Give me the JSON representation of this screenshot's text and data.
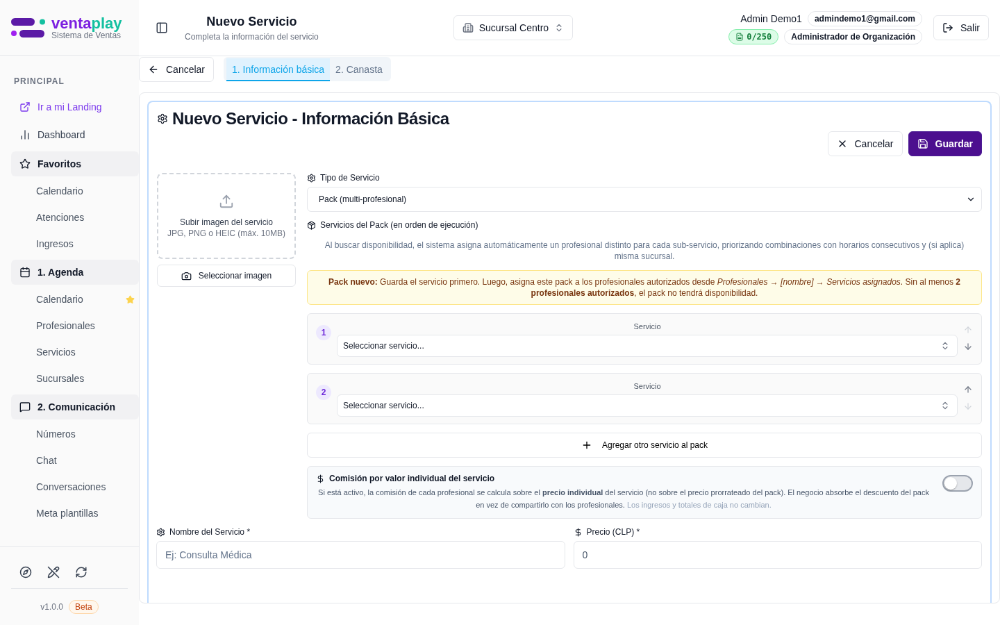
{
  "brand": {
    "name_a": "venta",
    "name_b": "play",
    "tagline": "Sistema de Ventas"
  },
  "header": {
    "title": "Nuevo Servicio",
    "subtitle": "Completa la información del servicio",
    "branch": "Sucursal Centro",
    "user": "Admin Demo1",
    "email": "admindemo1@gmail.com",
    "quota": "0/250",
    "role": "Administrador de Organización",
    "logout": "Salir"
  },
  "sidebar": {
    "section": "PRINCIPAL",
    "links": [
      {
        "label": "Ir a mi Landing",
        "kind": "external"
      },
      {
        "label": "Dashboard",
        "kind": "chart"
      }
    ],
    "groups": [
      {
        "label": "Favoritos",
        "kind": "star",
        "items": [
          {
            "label": "Calendario",
            "favorite": false
          },
          {
            "label": "Atenciones",
            "favorite": false
          },
          {
            "label": "Ingresos",
            "favorite": false
          }
        ]
      },
      {
        "label": "1. Agenda",
        "kind": "calendar",
        "items": [
          {
            "label": "Calendario",
            "favorite": true
          },
          {
            "label": "Profesionales",
            "favorite": false
          },
          {
            "label": "Servicios",
            "favorite": false
          },
          {
            "label": "Sucursales",
            "favorite": false
          }
        ]
      },
      {
        "label": "2. Comunicación",
        "kind": "message",
        "items": [
          {
            "label": "Números",
            "favorite": false
          },
          {
            "label": "Chat",
            "favorite": false
          },
          {
            "label": "Conversaciones",
            "favorite": false
          },
          {
            "label": "Meta plantillas",
            "favorite": false
          }
        ]
      }
    ],
    "version": "v1.0.0",
    "badge": "Beta"
  },
  "toolbar": {
    "cancel": "Cancelar",
    "tabs": [
      {
        "label": "1. Información básica",
        "selected": true
      },
      {
        "label": "2. Canasta",
        "selected": false
      }
    ]
  },
  "form": {
    "title": "Nuevo Servicio - Información Básica",
    "cancel": "Cancelar",
    "save": "Guardar",
    "upload": {
      "title": "Subir imagen del servicio",
      "hint": "JPG, PNG o HEIC (máx. 10MB)",
      "button": "Seleccionar imagen"
    },
    "type_label": "Tipo de Servicio",
    "type_value": "Pack (multi-profesional)",
    "pack_label": "Servicios del Pack (en orden de ejecución)",
    "pack_help": "Al buscar disponibilidad, el sistema asigna automáticamente un profesional distinto para cada sub-servicio, priorizando combinaciones con horarios consecutivos y (si aplica) misma sucursal.",
    "pack_notice": "**Pack nuevo:** Guarda el servicio primero. Luego, asigna este pack a los profesionales autorizados desde *Profesionales → [nombre] → Servicios asignados*. Sin al menos **2 profesionales autorizados**, el pack no tendrá disponibilidad.",
    "pack_items": [
      {
        "number": "1",
        "label": "Servicio",
        "value": "Seleccionar servicio...",
        "up_disabled": true,
        "down_disabled": false
      },
      {
        "number": "2",
        "label": "Servicio",
        "value": "Seleccionar servicio...",
        "up_disabled": false,
        "down_disabled": true
      }
    ],
    "add_item": "Agregar otro servicio al pack",
    "commission": {
      "title": "Comisión por valor individual del servicio",
      "description": "Si está activo, la comisión de cada profesional se calcula sobre el **precio individual** del servicio (no sobre el precio prorrateado del pack). El negocio absorbe el descuento del pack en vez de compartirlo con los profesionales.",
      "note": "Los ingresos y totales de caja no cambian.",
      "on": false
    },
    "name_label": "Nombre del Servicio *",
    "name_placeholder": "Ej: Consulta Médica",
    "price_label": "Precio (CLP) *",
    "price_value": "0"
  }
}
